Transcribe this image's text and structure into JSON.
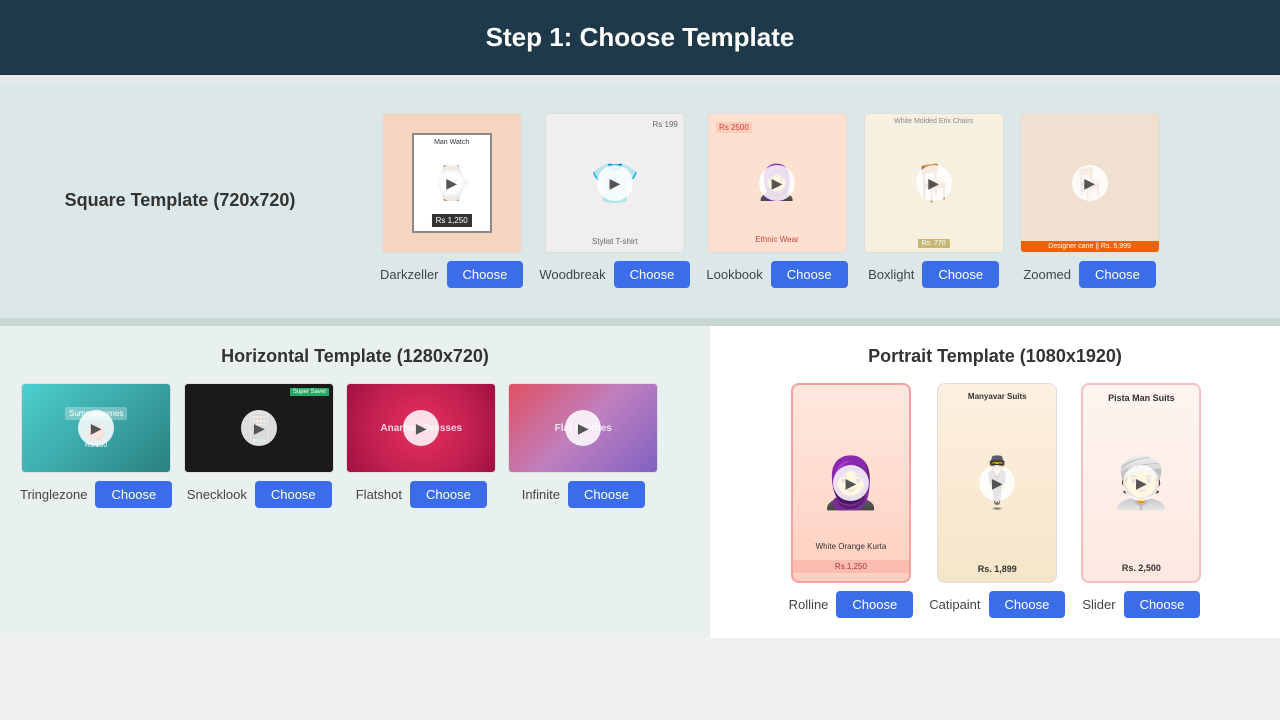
{
  "header": {
    "title": "Step 1: Choose Template"
  },
  "square_section": {
    "label": "Square Template (720x720)",
    "templates": [
      {
        "name": "Darkzeller",
        "type": "watch",
        "price": "Rs 1,250",
        "product_title": "Man Watch",
        "choose_label": "Choose"
      },
      {
        "name": "Woodbreak",
        "type": "shirt",
        "price": "Rs 199",
        "product_title": "Stylist T-shirt",
        "choose_label": "Choose"
      },
      {
        "name": "Lookbook",
        "type": "ethnic",
        "price": "Rs 2500",
        "product_title": "Ethnic Wear",
        "choose_label": "Choose"
      },
      {
        "name": "Boxlight",
        "type": "chair",
        "price": "Rs. 770",
        "product_title": "White Molded Erix Chairs",
        "choose_label": "Choose"
      },
      {
        "name": "Zoomed",
        "type": "hanging",
        "price": "Designer cane || Rs. 5,999",
        "choose_label": "Choose"
      }
    ]
  },
  "horizontal_section": {
    "label": "Horizontal Template (1280x720)",
    "templates": [
      {
        "name": "Tringlezone",
        "type": "tringlezone",
        "choose_label": "Choose"
      },
      {
        "name": "Snecklook",
        "type": "snecklook",
        "choose_label": "Choose"
      },
      {
        "name": "Flatshot",
        "type": "flatshot",
        "choose_label": "Choose"
      },
      {
        "name": "Infinite",
        "type": "infinite",
        "choose_label": "Choose"
      }
    ]
  },
  "portrait_section": {
    "label": "Portrait Template (1080x1920)",
    "templates": [
      {
        "name": "Rolline",
        "type": "woman",
        "product_title": "White Orange Kurta",
        "price": "Rs.1,250",
        "choose_label": "Choose"
      },
      {
        "name": "Catipaint",
        "type": "man-suit",
        "product_title": "Manyavar Suits",
        "price": "Rs. 1,899",
        "choose_label": "Choose"
      },
      {
        "name": "Slider",
        "type": "man-kurta",
        "price": "Rs. 2,500",
        "choose_label": "Choose",
        "product_title": "Pista Man Suits"
      }
    ]
  }
}
